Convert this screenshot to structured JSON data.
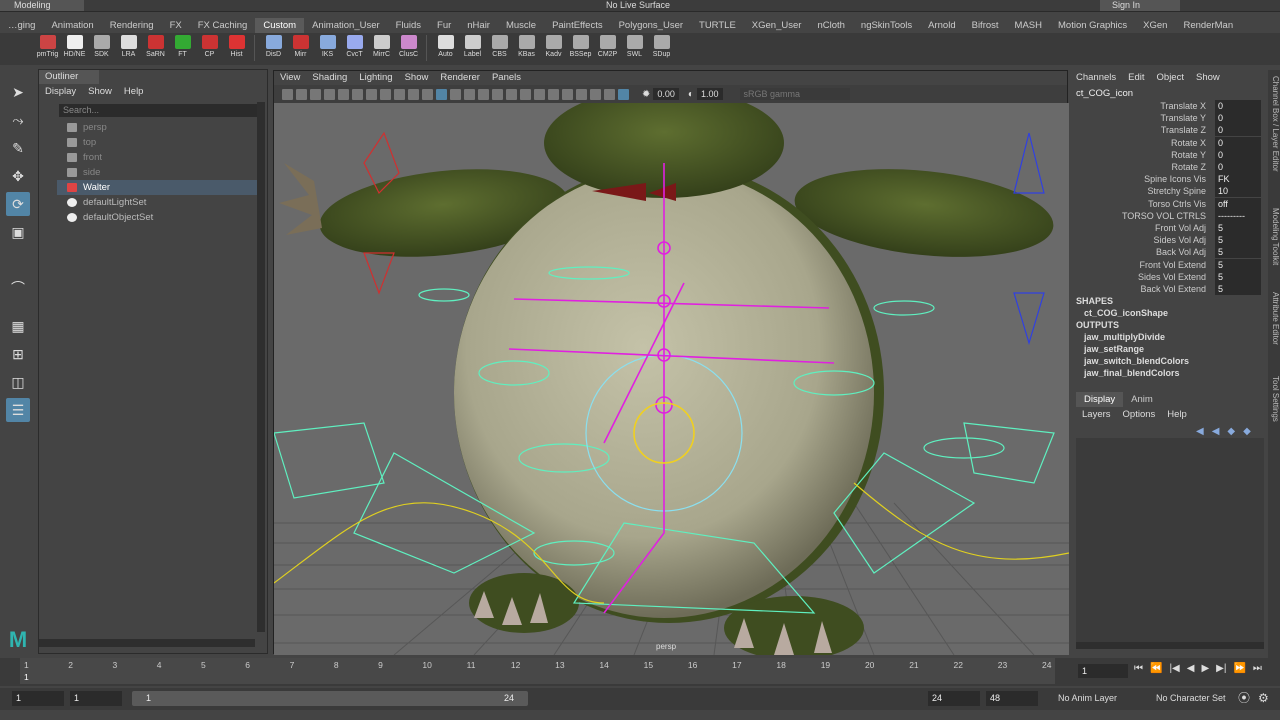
{
  "topbar": {
    "workspace": "Modeling",
    "live_surface": "No Live Surface",
    "sign_in": "Sign In"
  },
  "shelf_tabs": [
    "…ging",
    "Animation",
    "Rendering",
    "FX",
    "FX Caching",
    "Custom",
    "Animation_User",
    "Fluids",
    "Fur",
    "nHair",
    "Muscle",
    "PaintEffects",
    "Polygons_User",
    "TURTLE",
    "XGen_User",
    "nCloth",
    "ngSkinTools",
    "Arnold",
    "Bifrost",
    "MASH",
    "Motion Graphics",
    "XGen",
    "RenderMan"
  ],
  "active_shelf_tab": "Custom",
  "shelf_buttons_a": [
    "pmTrig",
    "HD/NE",
    "SDK",
    "LRA",
    "SaRN",
    "FT",
    "CP",
    "Hist"
  ],
  "shelf_buttons_b": [
    "DisD",
    "Mirr",
    "IKS",
    "CvcT",
    "MirrC",
    "ClusC"
  ],
  "shelf_buttons_c": [
    "Auto",
    "Label",
    "CBS",
    "KBas",
    "Kadv",
    "BSSep",
    "CM2P",
    "SWL",
    "SDup"
  ],
  "outliner": {
    "title": "Outliner",
    "menu": [
      "Display",
      "Show",
      "Help"
    ],
    "search_placeholder": "Search...",
    "items": [
      {
        "label": "persp",
        "type": "camera-icon"
      },
      {
        "label": "top",
        "type": "camera-icon"
      },
      {
        "label": "front",
        "type": "camera-icon"
      },
      {
        "label": "side",
        "type": "camera-icon"
      },
      {
        "label": "Walter",
        "type": "transform-icon"
      },
      {
        "label": "defaultLightSet",
        "type": "set-icon"
      },
      {
        "label": "defaultObjectSet",
        "type": "set-icon"
      }
    ]
  },
  "viewport": {
    "menu": [
      "View",
      "Shading",
      "Lighting",
      "Show",
      "Renderer",
      "Panels"
    ],
    "exposure": "0.00",
    "gamma": "1.00",
    "color_space": "sRGB gamma",
    "camera_label": "persp"
  },
  "channel_box": {
    "menu": [
      "Channels",
      "Edit",
      "Object",
      "Show"
    ],
    "object": "ct_COG_icon",
    "channels": [
      {
        "name": "Translate X",
        "value": "0"
      },
      {
        "name": "Translate Y",
        "value": "0"
      },
      {
        "name": "Translate Z",
        "value": "0"
      },
      {
        "name": "Rotate X",
        "value": "0"
      },
      {
        "name": "Rotate Y",
        "value": "0"
      },
      {
        "name": "Rotate Z",
        "value": "0"
      },
      {
        "name": "Spine Icons Vis",
        "value": "FK"
      },
      {
        "name": "Stretchy Spine",
        "value": "10"
      },
      {
        "name": "Torso Ctrls Vis",
        "value": "off"
      },
      {
        "name": "TORSO VOL CTRLS",
        "value": "---------"
      },
      {
        "name": "Front Vol Adj",
        "value": "5"
      },
      {
        "name": "Sides Vol Adj",
        "value": "5"
      },
      {
        "name": "Back Vol Adj",
        "value": "5"
      },
      {
        "name": "Front Vol Extend",
        "value": "5"
      },
      {
        "name": "Sides Vol Extend",
        "value": "5"
      },
      {
        "name": "Back Vol Extend",
        "value": "5"
      }
    ],
    "shapes_header": "SHAPES",
    "shapes": [
      "ct_COG_iconShape"
    ],
    "outputs_header": "OUTPUTS",
    "outputs": [
      "jaw_multiplyDivide",
      "jaw_setRange",
      "jaw_switch_blendColors",
      "jaw_final_blendColors"
    ]
  },
  "layer_editor": {
    "tabs": [
      "Display",
      "Anim"
    ],
    "menu": [
      "Layers",
      "Options",
      "Help"
    ]
  },
  "side_tabs": [
    "Channel Box / Layer Editor",
    "Modeling Toolkit",
    "Attribute Editor",
    "Tool Settings"
  ],
  "timeline": {
    "ticks": [
      "1",
      "2",
      "3",
      "4",
      "5",
      "6",
      "7",
      "8",
      "9",
      "10",
      "11",
      "12",
      "13",
      "14",
      "15",
      "16",
      "17",
      "18",
      "19",
      "20",
      "21",
      "22",
      "23",
      "24"
    ],
    "current_frame": "1"
  },
  "range": {
    "start": "1",
    "playback_start": "1",
    "slider_start": "1",
    "slider_end": "24",
    "playback_end": "24",
    "end": "48",
    "anim_layer": "No Anim Layer",
    "character_set": "No Character Set"
  },
  "colors": {
    "accent": "#5285a6",
    "rig_magenta": "#e020e0",
    "rig_cyan": "#5ff0c0",
    "rig_yellow": "#e0d020",
    "body": "#b0ae94",
    "skin": "#4e5e28"
  }
}
